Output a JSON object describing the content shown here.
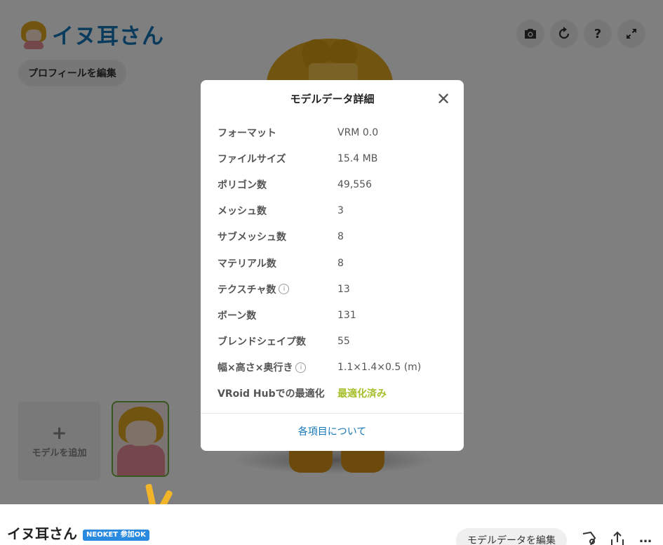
{
  "header": {
    "title": "イヌ耳さん",
    "edit_profile_label": "プロフィールを編集"
  },
  "toolbar": {
    "icons": [
      "camera-icon",
      "refresh-icon",
      "help-icon",
      "fullscreen-icon"
    ],
    "help_glyph": "?"
  },
  "models": {
    "add_label": "モデルを追加",
    "add_glyph": "+"
  },
  "modal": {
    "title": "モデルデータ詳細",
    "close_glyph": "✕",
    "rows": [
      {
        "label": "フォーマット",
        "value": "VRM 0.0"
      },
      {
        "label": "ファイルサイズ",
        "value": "15.4 MB"
      },
      {
        "label": "ポリゴン数",
        "value": "49,556"
      },
      {
        "label": "メッシュ数",
        "value": "3"
      },
      {
        "label": "サブメッシュ数",
        "value": "8"
      },
      {
        "label": "マテリアル数",
        "value": "8"
      },
      {
        "label": "テクスチャ数",
        "value": "13",
        "info": true
      },
      {
        "label": "ボーン数",
        "value": "131"
      },
      {
        "label": "ブレンドシェイプ数",
        "value": "55"
      },
      {
        "label": "幅×高さ×奥行き",
        "value": "1.1×1.4×0.5 (m)",
        "info": true
      },
      {
        "label": "VRoid Hubでの最適化",
        "value": "最適化済み",
        "highlight": true
      }
    ],
    "info_glyph": "i",
    "about_link": "各項目について"
  },
  "bottom": {
    "model_name": "イヌ耳さん",
    "badge": "NEOKET 参加OK",
    "edit_model_label": "モデルデータを編集",
    "more_glyph": "…"
  },
  "colors": {
    "brand_blue": "#1477b8",
    "optimized_green": "#a8be2b",
    "badge_blue": "#2a8ae0",
    "thumb_border": "#6fae3c"
  }
}
